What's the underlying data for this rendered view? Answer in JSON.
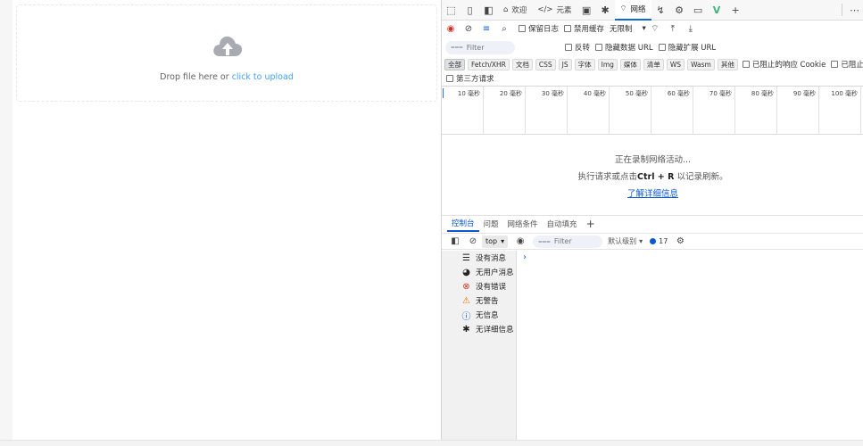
{
  "colors": {
    "link": "#409eff",
    "devtools_accent": "#0b57d0",
    "cloud": "#a8abb2",
    "record": "#d93025"
  },
  "upload": {
    "icon": "cloud-upload-icon",
    "prompt": "Drop file here or",
    "link": "click to upload"
  },
  "devtools": {
    "tabs": [
      {
        "icon": "home-icon",
        "label": "欢迎"
      },
      {
        "icon": "code-icon",
        "label": "元素"
      },
      {
        "icon": "wifi-icon",
        "label": "网络"
      }
    ],
    "network_toolbar": {
      "preserve_log": "保留日志",
      "disable_cache": "禁用缓存",
      "throttling": "无限制"
    },
    "filter": {
      "placeholder": "Filter",
      "invert": "反转",
      "hide_data_urls": "隐藏数据 URL",
      "hide_extension_urls": "隐藏扩展 URL"
    },
    "types": [
      "全部",
      "Fetch/XHR",
      "文档",
      "CSS",
      "JS",
      "字体",
      "Img",
      "媒体",
      "清单",
      "WS",
      "Wasm",
      "其他"
    ],
    "blocked_response_cookies": "已阻止的响应 Cookie",
    "blocked_requests": "已阻止请求",
    "third_party": "第三方请求",
    "timeline_ticks": [
      "10 毫秒",
      "20 毫秒",
      "30 毫秒",
      "40 毫秒",
      "50 毫秒",
      "60 毫秒",
      "70 毫秒",
      "80 毫秒",
      "90 毫秒",
      "100 毫秒"
    ],
    "empty": {
      "recording": "正在录制网络活动...",
      "hint_before": "执行请求或点击",
      "shortcut": "Ctrl + R",
      "hint_after": "以记录刷新。",
      "learn_more": "了解详细信息"
    },
    "drawer_tabs": [
      "控制台",
      "问题",
      "网络条件",
      "自动填充"
    ],
    "console": {
      "context": "top",
      "filter_placeholder": "Filter",
      "levels": "默认级别",
      "message_count": "17",
      "sidebar": [
        {
          "icon": "list-icon",
          "label": "没有消息"
        },
        {
          "icon": "user-icon",
          "label": "无用户消息"
        },
        {
          "icon": "error-icon",
          "label": "没有错误"
        },
        {
          "icon": "warning-icon",
          "label": "无警告"
        },
        {
          "icon": "info-icon",
          "label": "无信息"
        },
        {
          "icon": "bug-icon",
          "label": "无详细信息"
        }
      ],
      "prompt": "›"
    }
  }
}
